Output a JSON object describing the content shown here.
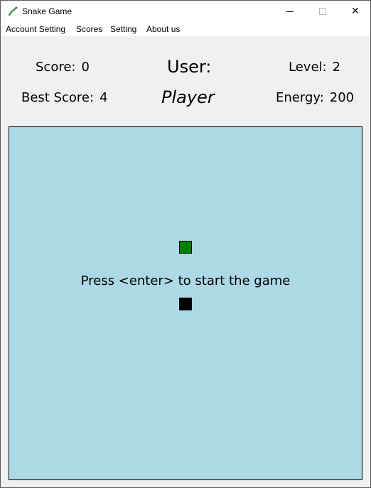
{
  "window": {
    "title": "Snake Game",
    "icon": "snake-icon",
    "controls": {
      "minimize": "minimize-icon",
      "maximize": "maximize-icon",
      "close": "close-icon",
      "close_glyph": "✕"
    }
  },
  "menu": [
    {
      "label": "Account Setting"
    },
    {
      "label": "Scores"
    },
    {
      "label": "Setting"
    },
    {
      "label": "About us"
    }
  ],
  "stats": {
    "score_label": "Score:",
    "score_value": "0",
    "best_score_label": "Best Score:",
    "best_score_value": "4",
    "level_label": "Level:",
    "level_value": "2",
    "energy_label": "Energy:",
    "energy_value": "200",
    "user_label": "User:",
    "player_name": "Player"
  },
  "game": {
    "message": "Press <enter> to start the game",
    "colors": {
      "background": "#add8e6",
      "food": "#008000",
      "snake": "#000000"
    }
  }
}
